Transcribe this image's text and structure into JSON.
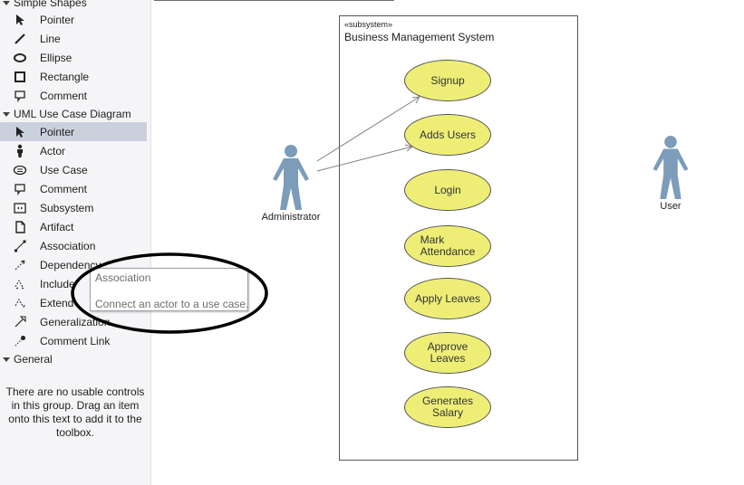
{
  "toolbox": {
    "groups": [
      {
        "name": "Simple Shapes",
        "items": [
          {
            "label": "Pointer",
            "icon": "pointer-icon"
          },
          {
            "label": "Line",
            "icon": "line-icon"
          },
          {
            "label": "Ellipse",
            "icon": "ellipse-icon"
          },
          {
            "label": "Rectangle",
            "icon": "rectangle-icon"
          },
          {
            "label": "Comment",
            "icon": "comment-icon"
          }
        ]
      },
      {
        "name": "UML Use Case Diagram",
        "items": [
          {
            "label": "Pointer",
            "icon": "pointer-icon",
            "selected": true
          },
          {
            "label": "Actor",
            "icon": "actor-icon"
          },
          {
            "label": "Use Case",
            "icon": "use-case-icon"
          },
          {
            "label": "Comment",
            "icon": "comment-icon"
          },
          {
            "label": "Subsystem",
            "icon": "subsystem-icon"
          },
          {
            "label": "Artifact",
            "icon": "artifact-icon"
          },
          {
            "label": "Association",
            "icon": "association-icon"
          },
          {
            "label": "Dependency",
            "icon": "dependency-icon"
          },
          {
            "label": "Include",
            "icon": "include-icon"
          },
          {
            "label": "Extend",
            "icon": "extend-icon"
          },
          {
            "label": "Generalization",
            "icon": "generalization-icon"
          },
          {
            "label": "Comment Link",
            "icon": "comment-link-icon"
          }
        ]
      },
      {
        "name": "General",
        "empty_message": "There are no usable controls in this group. Drag an item onto this text to add it to the toolbox."
      }
    ]
  },
  "tooltip": {
    "title": "Association",
    "description": "Connect an actor to a use case."
  },
  "diagram": {
    "subsystem": {
      "stereotype": "«subsystem»",
      "name": "Business Management System"
    },
    "use_cases": [
      {
        "label": "Signup"
      },
      {
        "label": "Adds Users"
      },
      {
        "label": "Login"
      },
      {
        "label": "Mark Attendance",
        "lines": [
          "Mark",
          "Attendance"
        ]
      },
      {
        "label": "Apply Leaves"
      },
      {
        "label": "Approve Leaves",
        "lines": [
          "Approve",
          "Leaves"
        ]
      },
      {
        "label": "Generates Salary",
        "lines": [
          "Generates",
          "Salary"
        ]
      }
    ],
    "actors": [
      {
        "name": "Administrator"
      },
      {
        "name": "User"
      }
    ],
    "colors": {
      "use_case_fill": "#eeee77",
      "actor_fill": "#7c9cba",
      "annotation": "#000000",
      "selection": "#cbd0dd"
    }
  }
}
